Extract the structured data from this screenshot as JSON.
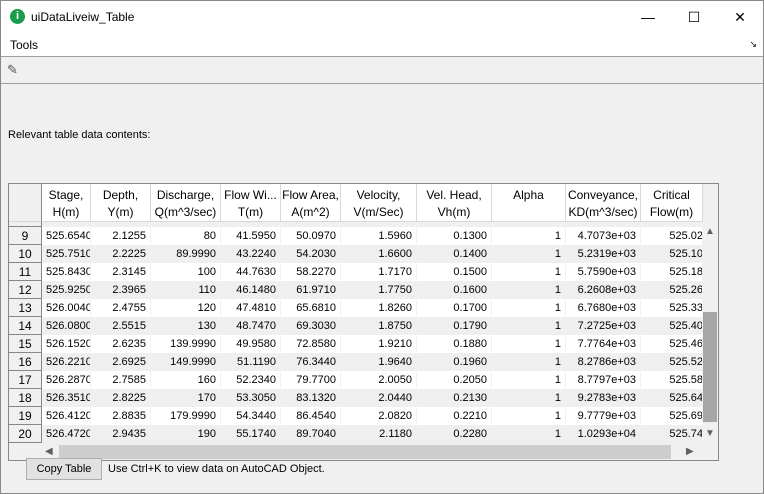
{
  "window": {
    "title": "uiDataLiveiw_Table",
    "minimize": "—",
    "maximize": "☐",
    "close": "✕"
  },
  "menu": {
    "tools": "Tools"
  },
  "label": "Relevant table data contents:",
  "table": {
    "columns": [
      "Stage,\nH(m)",
      "Depth,\nY(m)",
      "Discharge,\nQ(m^3/sec)",
      "Flow Wi...\nT(m)",
      "Flow Area,\nA(m^2)",
      "Velocity,\nV(m/Sec)",
      "Vel. Head,\nVh(m)",
      "Alpha",
      "Conveyance,\nKD(m^3/sec)",
      "Critical\nFlow(m)"
    ],
    "rows": [
      {
        "n": "9",
        "v": [
          "525.6540",
          "2.1255",
          "80",
          "41.5950",
          "50.0970",
          "1.5960",
          "0.1300",
          "1",
          "4.7073e+03",
          "525.02"
        ]
      },
      {
        "n": "10",
        "v": [
          "525.7510",
          "2.2225",
          "89.9990",
          "43.2240",
          "54.2030",
          "1.6600",
          "0.1400",
          "1",
          "5.2319e+03",
          "525.10"
        ]
      },
      {
        "n": "11",
        "v": [
          "525.8430",
          "2.3145",
          "100",
          "44.7630",
          "58.2270",
          "1.7170",
          "0.1500",
          "1",
          "5.7590e+03",
          "525.18"
        ]
      },
      {
        "n": "12",
        "v": [
          "525.9250",
          "2.3965",
          "110",
          "46.1480",
          "61.9710",
          "1.7750",
          "0.1600",
          "1",
          "6.2608e+03",
          "525.26"
        ]
      },
      {
        "n": "13",
        "v": [
          "526.0040",
          "2.4755",
          "120",
          "47.4810",
          "65.6810",
          "1.8260",
          "0.1700",
          "1",
          "6.7680e+03",
          "525.33"
        ]
      },
      {
        "n": "14",
        "v": [
          "526.0800",
          "2.5515",
          "130",
          "48.7470",
          "69.3030",
          "1.8750",
          "0.1790",
          "1",
          "7.2725e+03",
          "525.40"
        ]
      },
      {
        "n": "15",
        "v": [
          "526.1520",
          "2.6235",
          "139.9990",
          "49.9580",
          "72.8580",
          "1.9210",
          "0.1880",
          "1",
          "7.7764e+03",
          "525.46"
        ]
      },
      {
        "n": "16",
        "v": [
          "526.2210",
          "2.6925",
          "149.9990",
          "51.1190",
          "76.3440",
          "1.9640",
          "0.1960",
          "1",
          "8.2786e+03",
          "525.52"
        ]
      },
      {
        "n": "17",
        "v": [
          "526.2870",
          "2.7585",
          "160",
          "52.2340",
          "79.7700",
          "2.0050",
          "0.2050",
          "1",
          "8.7797e+03",
          "525.58"
        ]
      },
      {
        "n": "18",
        "v": [
          "526.3510",
          "2.8225",
          "170",
          "53.3050",
          "83.1320",
          "2.0440",
          "0.2130",
          "1",
          "9.2783e+03",
          "525.64"
        ]
      },
      {
        "n": "19",
        "v": [
          "526.4120",
          "2.8835",
          "179.9990",
          "54.3440",
          "86.4540",
          "2.0820",
          "0.2210",
          "1",
          "9.7779e+03",
          "525.69"
        ]
      },
      {
        "n": "20",
        "v": [
          "526.4720",
          "2.9435",
          "190",
          "55.1740",
          "89.7040",
          "2.1180",
          "0.2280",
          "1",
          "1.0293e+04",
          "525.74"
        ]
      }
    ]
  },
  "footer": {
    "copy_button": "Copy Table",
    "hint": "Use Ctrl+K to view data on AutoCAD Object."
  }
}
